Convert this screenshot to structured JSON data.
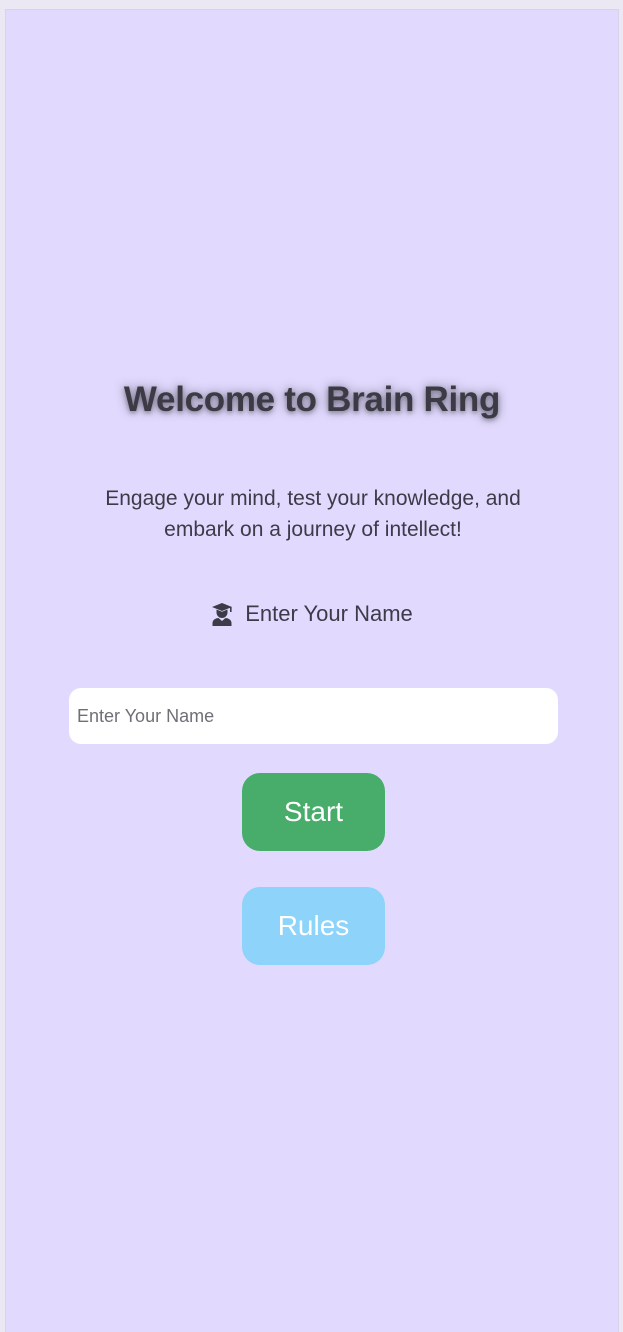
{
  "page": {
    "title": "Welcome to Brain Ring",
    "tagline": "Engage your mind, test your knowledge, and embark on a journey of intellect!"
  },
  "name_section": {
    "label": "Enter Your Name",
    "icon": "graduate-icon",
    "input_placeholder": "Enter Your Name",
    "input_value": ""
  },
  "buttons": {
    "start_label": "Start",
    "rules_label": "Rules"
  },
  "colors": {
    "background": "#e2dafe",
    "start_button": "#48ad6a",
    "rules_button": "#8dd3fa",
    "text": "#3d3b48"
  }
}
